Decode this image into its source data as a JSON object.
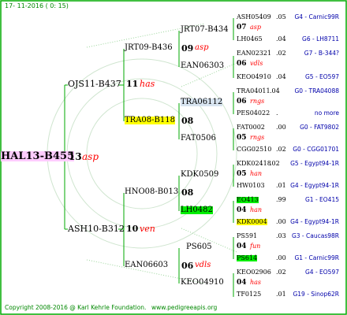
{
  "header": {
    "date": "17- 11-2016 ( 0: 15)"
  },
  "footer": {
    "copyright": "Copyright 2008-2016 @ Karl Kehrle Foundation.",
    "url": "www.pedigreeapis.org"
  },
  "colors": {
    "line": "#00aa00",
    "affiliation": "#ff0000",
    "location": "#0000aa",
    "dotted": "#99dd99",
    "highlight_yellow": "#ffff00",
    "highlight_green": "#00ee00",
    "highlight_pink": "#ffccff",
    "watermark": "#d9e8d9"
  },
  "root": {
    "name": "HAL13-B455",
    "num": "13",
    "aff": "asp"
  },
  "gen1": [
    {
      "name": "OJS11-B437",
      "num": "11",
      "aff": "has"
    },
    {
      "name": "ASH10-B312",
      "num": "10",
      "aff": "ven"
    }
  ],
  "gen2": [
    {
      "name": "JRT09-B436",
      "num": "09",
      "aff": "asp"
    },
    {
      "name": "TRA08-B118",
      "num": "08",
      "aff": ""
    },
    {
      "name": "HNO08-B013",
      "num": "08",
      "aff": ""
    },
    {
      "name": "EAN06603",
      "num": "06",
      "aff": "vdls"
    }
  ],
  "gen3": [
    {
      "name": "JRT07-B434",
      "num": "07",
      "aff": "asp"
    },
    {
      "name": "EAN06303",
      "num": "",
      "aff": ""
    },
    {
      "name": "TRA06112",
      "num": "",
      "aff": ""
    },
    {
      "name": "FAT0506",
      "num": "",
      "aff": ""
    },
    {
      "name": "KDK0509",
      "num": "",
      "aff": ""
    },
    {
      "name": "LH0482",
      "num": "",
      "aff": ""
    },
    {
      "name": "PS605",
      "num": "",
      "aff": ""
    },
    {
      "name": "KEO04910",
      "num": "",
      "aff": ""
    }
  ],
  "gen4": [
    {
      "name": "ASH05409",
      "val": ".05",
      "loc": "G4 - Carnic99R",
      "num": "07",
      "aff": "asp"
    },
    {
      "name": "LH0465",
      "val": ".04",
      "loc": "G6 - LH8711",
      "num": "",
      "aff": ""
    },
    {
      "name": "EAN02321",
      "val": ".02",
      "loc": "G7 - B-344?",
      "num": "06",
      "aff": "vdls"
    },
    {
      "name": "KEO04910",
      "val": ".04",
      "loc": "G5 - EO597",
      "num": "",
      "aff": ""
    },
    {
      "name": "TRA04011",
      "val": ".04",
      "loc": "G0 - TRA04088",
      "num": "06",
      "aff": "rngs"
    },
    {
      "name": "PES04022",
      "val": ".",
      "loc": "no more",
      "num": "",
      "aff": ""
    },
    {
      "name": "FAT0002",
      "val": ".00",
      "loc": "G0 - FAT9802",
      "num": "05",
      "aff": "rngs"
    },
    {
      "name": "CGG02510",
      "val": ".02",
      "loc": "G0 - CGG01701",
      "num": "",
      "aff": ""
    },
    {
      "name": "KDK02418",
      "val": ".02",
      "loc": "G5 - Egypt94-1R",
      "num": "05",
      "aff": "han"
    },
    {
      "name": "HW0103",
      "val": ".01",
      "loc": "G4 - Egypt94-1R",
      "num": "",
      "aff": ""
    },
    {
      "name": "EO413",
      "val": ".99",
      "loc": "G1 - EO415",
      "num": "04",
      "aff": "han"
    },
    {
      "name": "KDK0004",
      "val": ".00",
      "loc": "G4 - Egypt94-1R",
      "num": "",
      "aff": ""
    },
    {
      "name": "PS591",
      "val": ".03",
      "loc": "G3 - Caucas98R",
      "num": "04",
      "aff": "fun"
    },
    {
      "name": "PS614",
      "val": ".00",
      "loc": "G1 - Carnic99R",
      "num": "",
      "aff": ""
    },
    {
      "name": "KEO02906",
      "val": ".02",
      "loc": "G4 - EO597",
      "num": "04",
      "aff": "has"
    },
    {
      "name": "TF0125",
      "val": ".01",
      "loc": "G19 - Sinop62R",
      "num": "",
      "aff": ""
    }
  ]
}
